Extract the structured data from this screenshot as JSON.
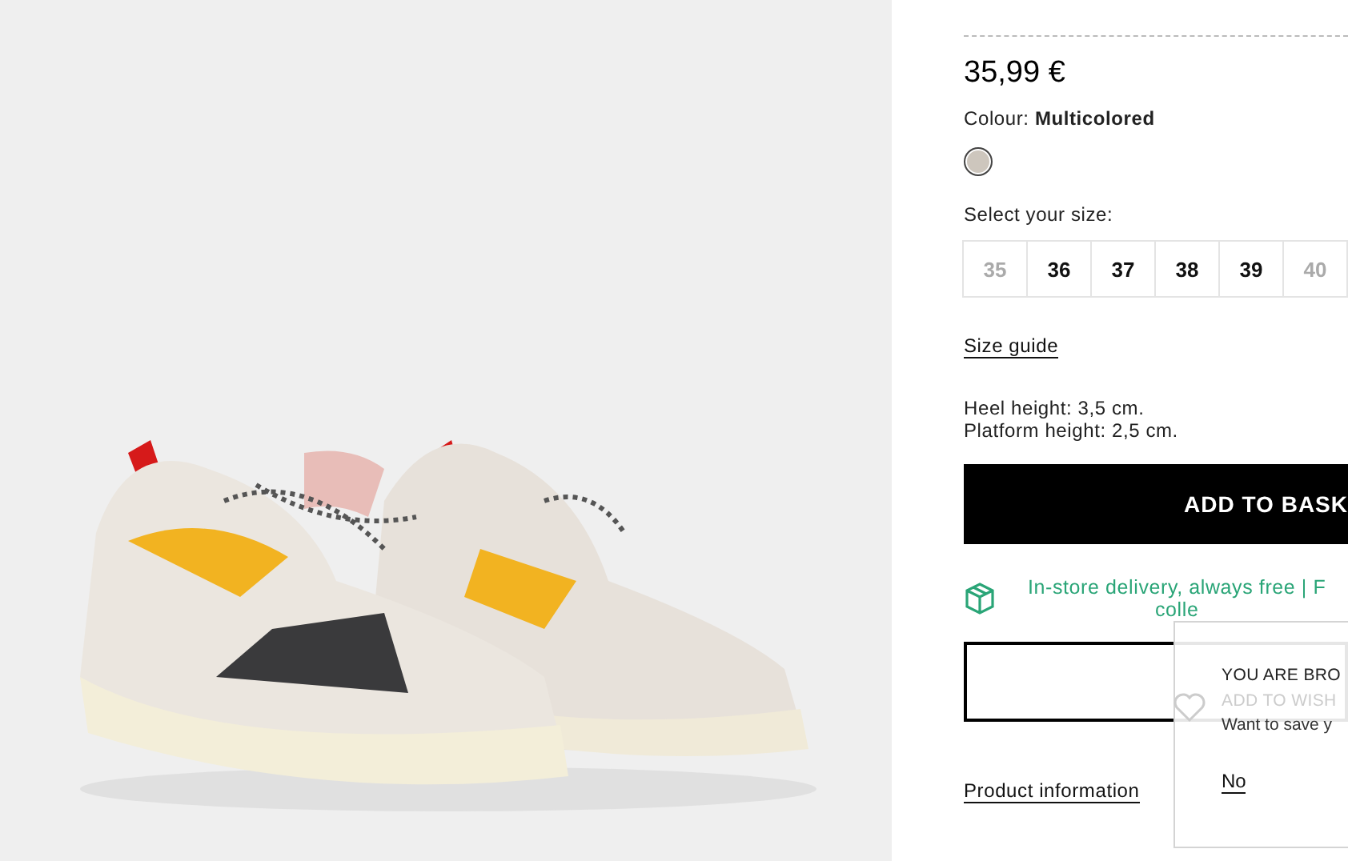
{
  "product": {
    "price": "35,99 €",
    "colour_label": "Colour:",
    "colour_value": "Multicolored",
    "swatches": [
      {
        "color": "#cdc6bd",
        "selected": true
      }
    ],
    "size_label": "Select your size:",
    "sizes": [
      {
        "label": "35",
        "disabled": true
      },
      {
        "label": "36",
        "disabled": false
      },
      {
        "label": "37",
        "disabled": false
      },
      {
        "label": "38",
        "disabled": false
      },
      {
        "label": "39",
        "disabled": false
      },
      {
        "label": "40",
        "disabled": true
      }
    ],
    "size_guide": "Size guide",
    "details": [
      "Heel height: 3,5 cm.",
      "Platform height: 2,5 cm."
    ],
    "add_to_basket": "ADD TO BASK",
    "delivery": [
      "In-store delivery, always free | F",
      "colle"
    ],
    "product_information": "Product information"
  },
  "popup": {
    "title": "YOU ARE BRO",
    "faded_line": "ADD TO WISH",
    "message": "Want to save y",
    "no_link": "No"
  }
}
